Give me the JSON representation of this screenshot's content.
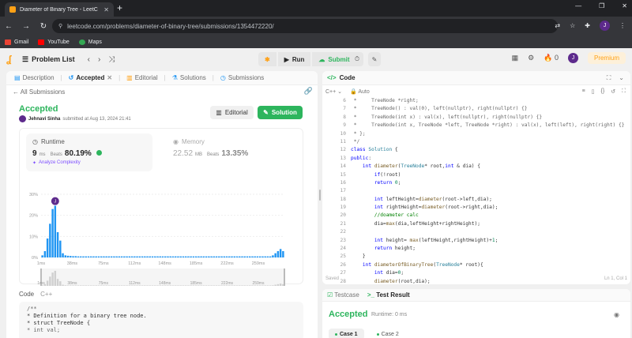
{
  "browser": {
    "tab_title": "Diameter of Binary Tree - LeetC",
    "tab_close": "✕",
    "new_tab": "+",
    "url": "leetcode.com/problems/diameter-of-binary-tree/submissions/1354472220/",
    "window_controls": [
      "—",
      "❐",
      "✕"
    ],
    "profile_initial": "J",
    "bookmarks": [
      {
        "label": "Gmail",
        "color": "#ea4335"
      },
      {
        "label": "YouTube",
        "color": "#ff0000"
      },
      {
        "label": "Maps",
        "color": "#34a853"
      }
    ]
  },
  "header": {
    "problem_list": "Problem List",
    "run": "Run",
    "submit": "Submit",
    "streak": "0",
    "user_initial": "J",
    "premium": "Premium"
  },
  "left": {
    "tabs": [
      {
        "label": "Description",
        "icon": "description-icon"
      },
      {
        "label": "Accepted",
        "icon": "history-icon"
      },
      {
        "label": "Editorial",
        "icon": "book-icon"
      },
      {
        "label": "Solutions",
        "icon": "flask-icon"
      },
      {
        "label": "Submissions",
        "icon": "clock-icon"
      }
    ],
    "all_submissions": "All Submissions",
    "status": "Accepted",
    "author": "Jehnavi Sinha",
    "submitted_text": "submitted at Aug 13, 2024 21:41",
    "editorial_btn": "Editorial",
    "solution_btn": "Solution",
    "runtime": {
      "label": "Runtime",
      "value": "9",
      "unit": "ms",
      "beats_label": "Beats",
      "beats": "80.19%",
      "analyze": "Analyze Complexity"
    },
    "memory": {
      "label": "Memory",
      "value": "22.52",
      "unit": "MB",
      "beats_label": "Beats",
      "beats": "13.35%"
    },
    "code_label": "Code",
    "code_lang": "C++",
    "code_preview": [
      "/**",
      " * Definition for a binary tree node.",
      " * struct TreeNode {",
      " *     int val;"
    ]
  },
  "chart_data": {
    "type": "bar",
    "yticks": [
      "30%",
      "20%",
      "10%",
      "0%"
    ],
    "ylim": [
      0,
      30
    ],
    "xticks": [
      "1ms",
      "38ms",
      "75ms",
      "112ms",
      "148ms",
      "185ms",
      "222ms",
      "259ms"
    ],
    "x_range_ms": [
      1,
      290
    ],
    "values": [
      1,
      3,
      9,
      16,
      23,
      26,
      12,
      8,
      2,
      1,
      0.8,
      0.7,
      0.6,
      0.6,
      0.5,
      0.5,
      0.5,
      0.5,
      0.5,
      0.5,
      0.5,
      0.5,
      0.5,
      0.5,
      0.5,
      0.5,
      0.5,
      0.5,
      0.5,
      0.5,
      0.5,
      0.5,
      0.5,
      0.5,
      0.5,
      0.5,
      0.5,
      0.5,
      0.5,
      0.5,
      0.5,
      0.5,
      0.5,
      0.5,
      0.5,
      0.5,
      0.5,
      0.5,
      0.5,
      0.5,
      0.5,
      0.5,
      0.5,
      0.5,
      0.5,
      0.5,
      0.5,
      0.5,
      0.5,
      0.5,
      0.5,
      0.5,
      0.5,
      0.5,
      0.5,
      0.5,
      0.5,
      0.5,
      0.5,
      0.5,
      0.5,
      0.5,
      0.5,
      0.5,
      0.5,
      0.5,
      0.5,
      0.5,
      0.5,
      0.5,
      0.5,
      0.5,
      0.5,
      0.5,
      0.5,
      0.5,
      0.5,
      0.5,
      0.5,
      0.5,
      1,
      2,
      3,
      4,
      3
    ],
    "highlight_index": 5,
    "marker_label": "J",
    "bar_color": "#2196f3",
    "overview_color": "#d0d0d0"
  },
  "right": {
    "panel_title": "Code",
    "lang": "C++",
    "mode": "Auto",
    "start_line": 6,
    "code_lines": [
      " *     TreeNode *right;",
      " *     TreeNode() : val(0), left(nullptr), right(nullptr) {}",
      " *     TreeNode(int x) : val(x), left(nullptr), right(nullptr) {}",
      " *     TreeNode(int x, TreeNode *left, TreeNode *right) : val(x), left(left), right(right) {}",
      " * };",
      " */",
      "class Solution {",
      "public:",
      "    int diameter(TreeNode* root,int & dia) {",
      "        if(!root)",
      "        return 0;",
      "",
      "        int leftHeight=diameter(root->left,dia);",
      "        int rightHeight=diameter(root->right,dia);",
      "        //doameter calc",
      "        dia=max(dia,leftHeight+rightHeight);",
      "",
      "        int height= max(leftHeight,rightHeight)+1;",
      "        return height;",
      "    }",
      "    int diameterOfBinaryTree(TreeNode* root){",
      "        int dia=0;",
      "        diameter(root,dia);"
    ],
    "saved": "Saved",
    "cursor": "Ln 1, Col 1"
  },
  "bottom": {
    "tab_testcase": "Testcase",
    "tab_result": "Test Result",
    "result": "Accepted",
    "runtime": "Runtime: 0 ms",
    "cases": [
      "Case 1",
      "Case 2"
    ]
  }
}
